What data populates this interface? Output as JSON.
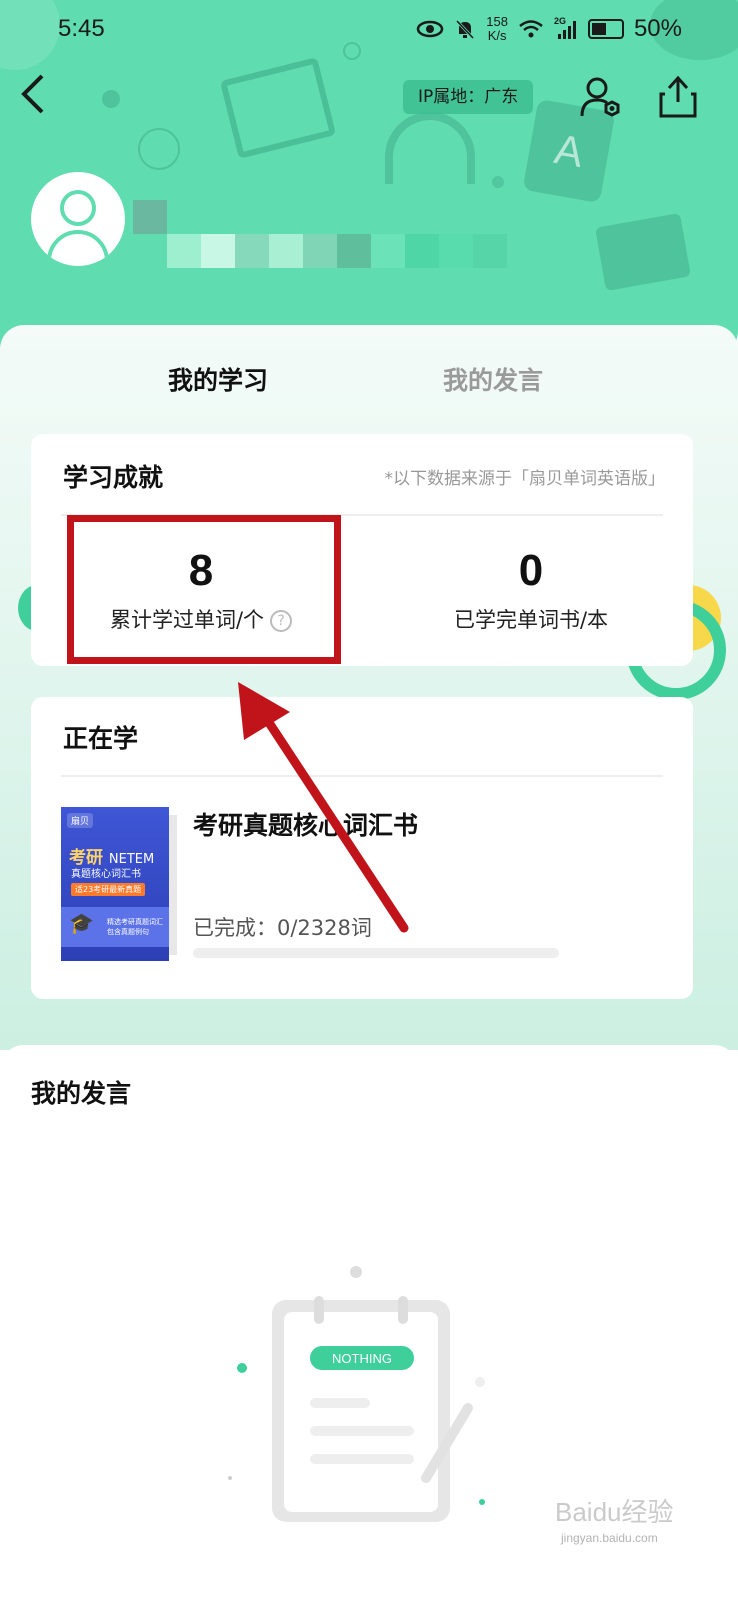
{
  "status_bar": {
    "time": "5:45",
    "network_speed_value": "158",
    "network_speed_unit": "K/s",
    "network_type": "2G",
    "battery_percent": "50%"
  },
  "header": {
    "ip_location": "IP属地：广东"
  },
  "tabs": [
    {
      "label": "我的学习",
      "active": true
    },
    {
      "label": "我的发言",
      "active": false
    }
  ],
  "achievements": {
    "title": "学习成就",
    "note": "*以下数据来源于「扇贝单词英语版」",
    "stats": [
      {
        "value": "8",
        "label": "累计学过单词/个"
      },
      {
        "value": "0",
        "label": "已学完单词书/本"
      }
    ]
  },
  "learning": {
    "title": "正在学",
    "book": {
      "name": "考研真题核心词汇书",
      "progress_text": "已完成：0/2328词",
      "progress_fraction": 0,
      "cover": {
        "brand": "扇贝",
        "title_main": "考研",
        "title_en": "NETEM",
        "subtitle": "真题核心词汇书",
        "strip": "适23考研最新真题",
        "small_line1": "精选考研真题词汇",
        "small_line2": "包含真题例句"
      }
    }
  },
  "speech": {
    "title": "我的发言",
    "empty_label": "NOTHING"
  },
  "watermark": {
    "main": "Baidu经验",
    "sub": "jingyan.baidu.com"
  },
  "colors": {
    "header_green": "#5fdcb0",
    "accent_green": "#3fcf9b",
    "highlight_red": "#c0141a",
    "arrow_red": "#c0141a"
  },
  "icons": [
    "back-arrow-icon",
    "user-settings-icon",
    "share-icon",
    "help-icon",
    "eye-icon",
    "mute-bell-icon",
    "wifi-icon",
    "signal-icon",
    "battery-icon"
  ]
}
